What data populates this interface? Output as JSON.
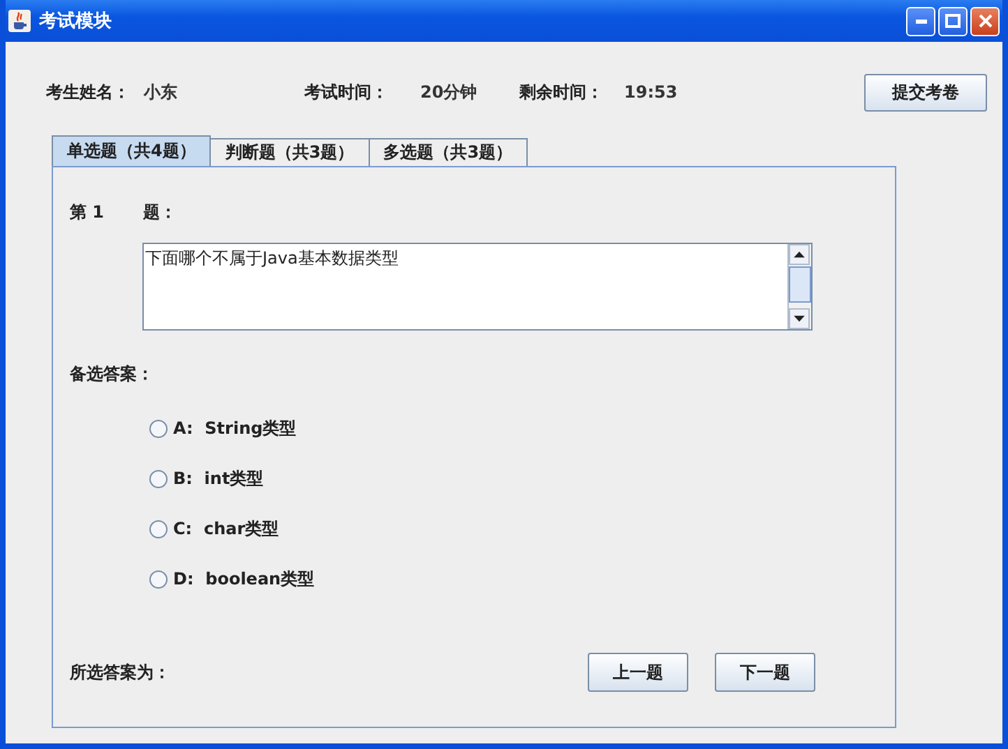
{
  "window": {
    "title": "考试模块"
  },
  "header": {
    "name_label": "考生姓名：",
    "name_value": "小东",
    "time_label": "考试时间：",
    "time_value": "20分钟",
    "remain_label": "剩余时间：",
    "remain_value": "19:53",
    "submit": "提交考卷"
  },
  "tabs": [
    {
      "label": "单选题（共4题）",
      "selected": true
    },
    {
      "label": "判断题（共3题）",
      "selected": false
    },
    {
      "label": "多选题（共3题）",
      "selected": false
    }
  ],
  "question": {
    "number_label": "第 1",
    "suffix": "题：",
    "text": "下面哪个不属于Java基本数据类型"
  },
  "answers_label": "备选答案：",
  "options": [
    {
      "label": "A:  String类型",
      "selected": false
    },
    {
      "label": "B:  int类型",
      "selected": false
    },
    {
      "label": "C:  char类型",
      "selected": false
    },
    {
      "label": "D:  boolean类型",
      "selected": false
    }
  ],
  "footer": {
    "chosen_label": "所选答案为：",
    "prev": "上一题",
    "next": "下一题"
  }
}
